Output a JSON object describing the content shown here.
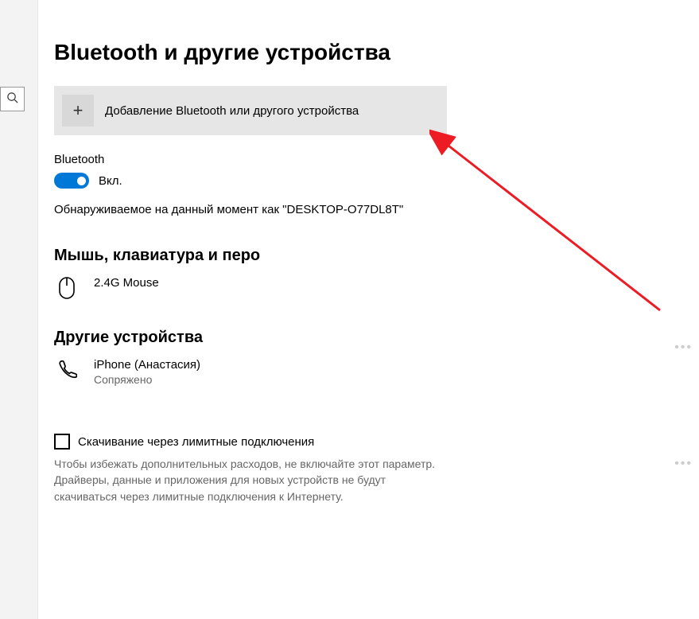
{
  "header": {
    "title": "Bluetooth и другие устройства"
  },
  "add_device": {
    "label": "Добавление Bluetooth или другого устройства"
  },
  "bluetooth": {
    "label": "Bluetooth",
    "state_label": "Вкл.",
    "discoverable_text": "Обнаруживаемое на данный момент как \"DESKTOP-O77DL8T\""
  },
  "sections": {
    "mouse_keyboard_pen": {
      "title": "Мышь, клавиатура и перо",
      "devices": [
        {
          "name": "2.4G Mouse",
          "status": "",
          "icon": "mouse-icon"
        }
      ]
    },
    "other_devices": {
      "title": "Другие устройства",
      "devices": [
        {
          "name": "iPhone (Анастасия)",
          "status": "Сопряжено",
          "icon": "phone-icon"
        }
      ]
    }
  },
  "metered": {
    "checkbox_label": "Скачивание через лимитные подключения",
    "description": "Чтобы избежать дополнительных расходов, не включайте этот параметр. Драйверы, данные и приложения для новых устройств не будут скачиваться через лимитные подключения к Интернету."
  },
  "colors": {
    "accent": "#0078d7",
    "arrow": "#ed1c24"
  }
}
